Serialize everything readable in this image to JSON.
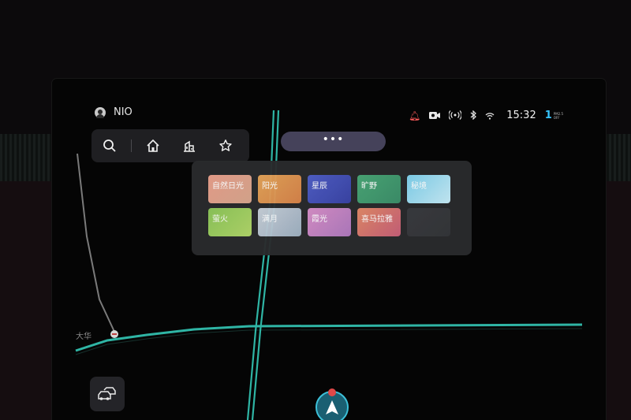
{
  "status_bar": {
    "user_name": "NIO",
    "time": "15:32",
    "air_quality": {
      "value": "1",
      "label_top": "PM2.5",
      "label_bottom": "OFF"
    },
    "icons": [
      "bell-icon",
      "camera-icon",
      "cellular-icon",
      "bluetooth-icon",
      "wifi-icon"
    ]
  },
  "nav_bar": {
    "buttons": [
      "search-icon",
      "home-icon",
      "company-icon",
      "favorite-icon"
    ]
  },
  "more_pill": {
    "label": "•••"
  },
  "theme_panel": {
    "themes": [
      {
        "label": "自然日光",
        "colors": [
          "#e9a08c",
          "#d9a88f"
        ]
      },
      {
        "label": "阳光",
        "colors": [
          "#e4a55a",
          "#d8844a"
        ]
      },
      {
        "label": "星辰",
        "colors": [
          "#5060c8",
          "#3b44a6"
        ]
      },
      {
        "label": "旷野",
        "colors": [
          "#4aa877",
          "#3d8f6b"
        ]
      },
      {
        "label": "秘境",
        "colors": [
          "#7fd2ee",
          "#c8ecf8"
        ]
      },
      {
        "label": "萤火",
        "colors": [
          "#8cc65a",
          "#b3d86a"
        ]
      },
      {
        "label": "满月",
        "colors": [
          "#c9d1da",
          "#9fb1c2"
        ]
      },
      {
        "label": "霞光",
        "colors": [
          "#d890c8",
          "#b07ac0"
        ]
      },
      {
        "label": "喜马拉雅",
        "colors": [
          "#e38a68",
          "#c8607a"
        ]
      },
      {
        "label": "",
        "colors": [
          "#3a3c40",
          "#34363a"
        ]
      }
    ]
  },
  "map": {
    "road_label": "大华",
    "road_color": "#2fb5a5"
  },
  "colors": {
    "accent": "#37c6ff",
    "alert": "#ff5a5a",
    "pill": "#45425a"
  }
}
